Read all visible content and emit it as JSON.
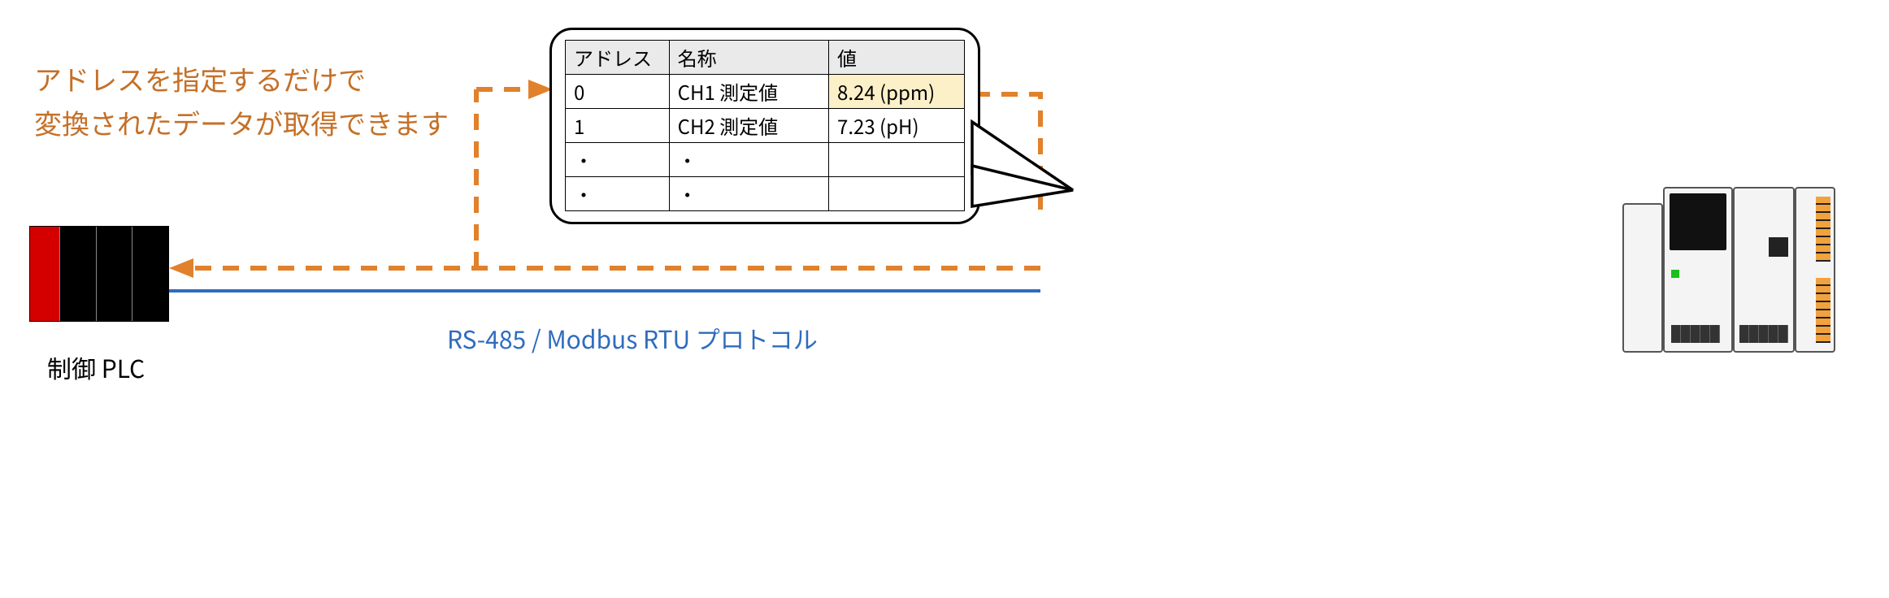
{
  "caption_line1": "アドレスを指定するだけで",
  "caption_line2": "変換されたデータが取得できます",
  "plc_label": "制御 PLC",
  "bus_label": "RS-485 / Modbus RTU プロトコル",
  "table": {
    "headers": {
      "addr": "アドレス",
      "name": "名称",
      "value": "値"
    },
    "rows": [
      {
        "addr": "0",
        "name": "CH1  測定値",
        "value": "8.24 (ppm)",
        "highlight": true
      },
      {
        "addr": "1",
        "name": "CH2  測定値",
        "value": "7.23 (pH)",
        "highlight": false
      }
    ],
    "dot": "・"
  },
  "colors": {
    "accent_orange": "#e1812c",
    "text_orange": "#c57027",
    "bus_blue": "#2f6cbf",
    "plc_red": "#d40000",
    "highlight_bg": "#fbf0c8"
  },
  "devices": {
    "left": "control-plc",
    "right": "measurement-module"
  }
}
